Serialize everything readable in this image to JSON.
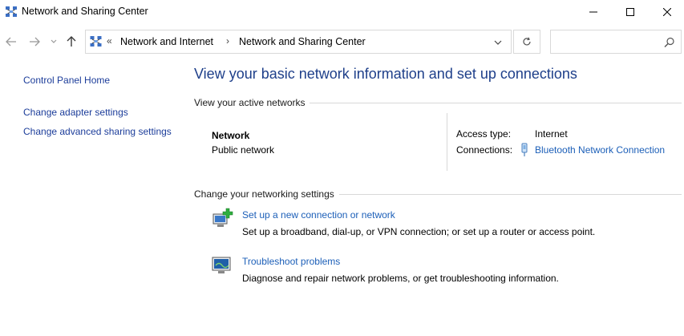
{
  "window": {
    "title": "Network and Sharing Center",
    "controls": {
      "minimize": "minimize",
      "maximize": "maximize",
      "close": "close"
    }
  },
  "address_bar": {
    "overflow_glyph": "«",
    "breadcrumbs": [
      "Network and Internet",
      "Network and Sharing Center"
    ],
    "separator": "›"
  },
  "search": {
    "placeholder": "",
    "value": ""
  },
  "left_pane": {
    "home": "Control Panel Home",
    "links": [
      "Change adapter settings",
      "Change advanced sharing settings"
    ]
  },
  "main": {
    "title": "View your basic network information and set up connections",
    "active_networks": {
      "heading": "View your active networks",
      "network_name": "Network",
      "network_type": "Public network",
      "access_type_label": "Access type:",
      "access_type_value": "Internet",
      "connections_label": "Connections:",
      "connections_value": "Bluetooth Network Connection"
    },
    "change_settings": {
      "heading": "Change your networking settings",
      "items": [
        {
          "link": "Set up a new connection or network",
          "description": "Set up a broadband, dial-up, or VPN connection; or set up a router or access point."
        },
        {
          "link": "Troubleshoot problems",
          "description": "Diagnose and repair network problems, or get troubleshooting information."
        }
      ]
    }
  },
  "colors": {
    "title_blue": "#1e3f8a",
    "link_blue": "#1c5fb8",
    "border": "#d9d9d9"
  }
}
